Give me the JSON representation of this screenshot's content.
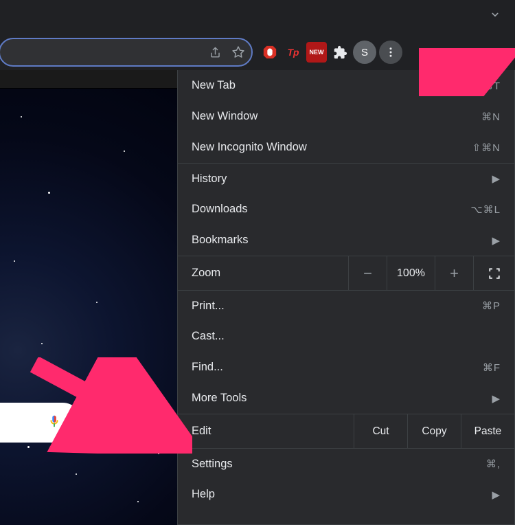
{
  "toolbar": {
    "avatar_letter": "S",
    "ext_tp": "Tp",
    "ext_new": "NEW"
  },
  "menu": {
    "groups": [
      [
        {
          "label": "New Tab",
          "shortcut": "⌘T"
        },
        {
          "label": "New Window",
          "shortcut": "⌘N"
        },
        {
          "label": "New Incognito Window",
          "shortcut": "⇧⌘N"
        }
      ],
      [
        {
          "label": "History",
          "shortcut": "▶"
        },
        {
          "label": "Downloads",
          "shortcut": "⌥⌘L"
        },
        {
          "label": "Bookmarks",
          "shortcut": "▶"
        }
      ]
    ],
    "zoom": {
      "label": "Zoom",
      "percent": "100%"
    },
    "secondGroups": [
      [
        {
          "label": "Print...",
          "shortcut": "⌘P"
        },
        {
          "label": "Cast...",
          "shortcut": ""
        },
        {
          "label": "Find...",
          "shortcut": "⌘F"
        },
        {
          "label": "More Tools",
          "shortcut": "▶"
        }
      ]
    ],
    "edit": {
      "label": "Edit",
      "cut": "Cut",
      "copy": "Copy",
      "paste": "Paste"
    },
    "thirdGroups": [
      [
        {
          "label": "Settings",
          "shortcut": "⌘,"
        },
        {
          "label": "Help",
          "shortcut": "▶"
        }
      ]
    ]
  }
}
